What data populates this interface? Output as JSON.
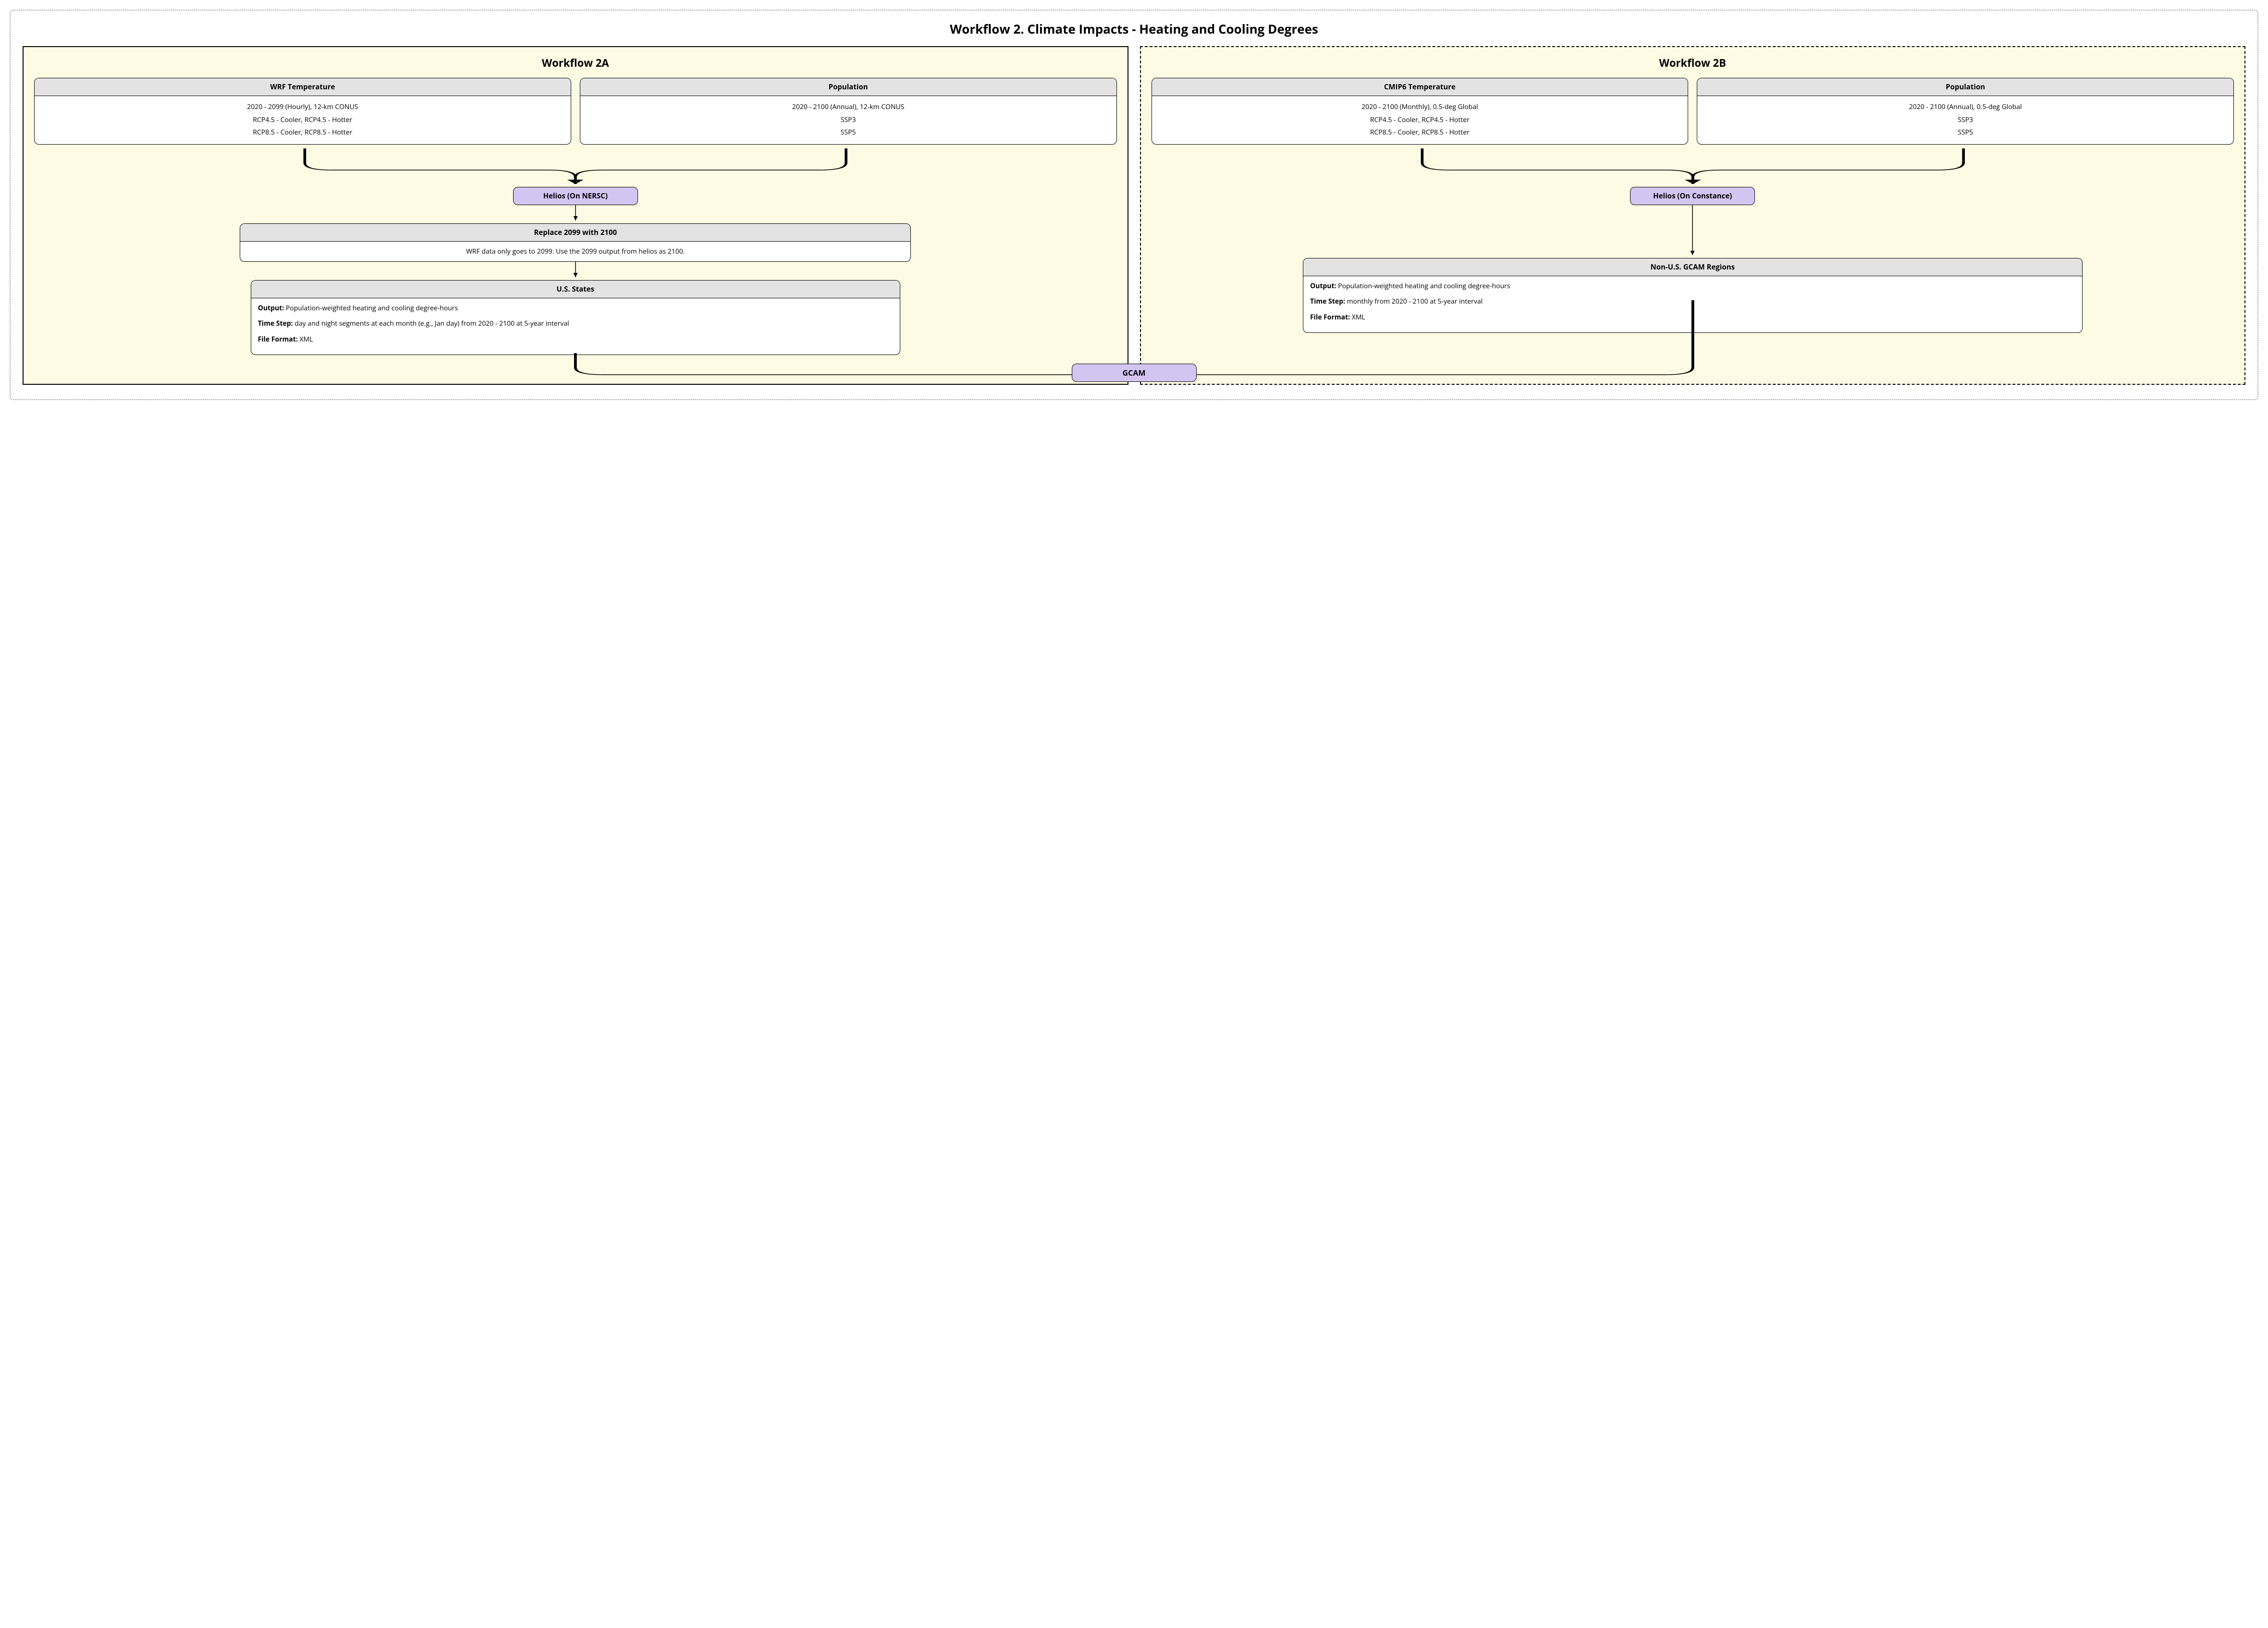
{
  "main_title": "Workflow 2. Climate Impacts - Heating and Cooling Degrees",
  "panel_a": {
    "title": "Workflow 2A",
    "wrf": {
      "header": "WRF Temperature",
      "line1": "2020 - 2099 (Hourly), 12-km CONUS",
      "line2": "RCP4.5 - Cooler, RCP4.5 - Hotter",
      "line3": "RCP8.5 - Cooler, RCP8.5 - Hotter"
    },
    "pop": {
      "header": "Population",
      "line1": "2020 - 2100 (Annual), 12-km CONUS",
      "line2": "SSP3",
      "line3": "SSP5"
    },
    "helios": "Helios (On NERSC)",
    "replace": {
      "header": "Replace 2099 with 2100",
      "body": "WRF data only goes to 2099. Use the 2099 output from helios as 2100."
    },
    "output": {
      "header": "U.S. States",
      "out_label": "Output:",
      "out_val": " Population-weighted heating and cooling degree-hours",
      "ts_label": "Time Step:",
      "ts_val": " day and night segments at each month (e.g., Jan day) from 2020 - 2100 at 5-year interval",
      "ff_label": "File Format:",
      "ff_val": " XML"
    }
  },
  "panel_b": {
    "title": "Workflow 2B",
    "cmip": {
      "header": "CMIP6 Temperature",
      "line1": "2020 - 2100 (Monthly), 0.5-deg Global",
      "line2": "RCP4.5 - Cooler, RCP4.5 - Hotter",
      "line3": "RCP8.5 - Cooler, RCP8.5 - Hotter"
    },
    "pop": {
      "header": "Population",
      "line1": "2020 - 2100 (Annual), 0.5-deg Global",
      "line2": "SSP3",
      "line3": "SSP5"
    },
    "helios": "Helios (On Constance)",
    "output": {
      "header": "Non-U.S. GCAM Regions",
      "out_label": "Output:",
      "out_val": " Population-weighted heating and cooling degree-hours",
      "ts_label": "Time Step:",
      "ts_val": " monthly from 2020 - 2100 at 5-year interval",
      "ff_label": "File Format:",
      "ff_val": " XML"
    }
  },
  "gcam": "GCAM"
}
